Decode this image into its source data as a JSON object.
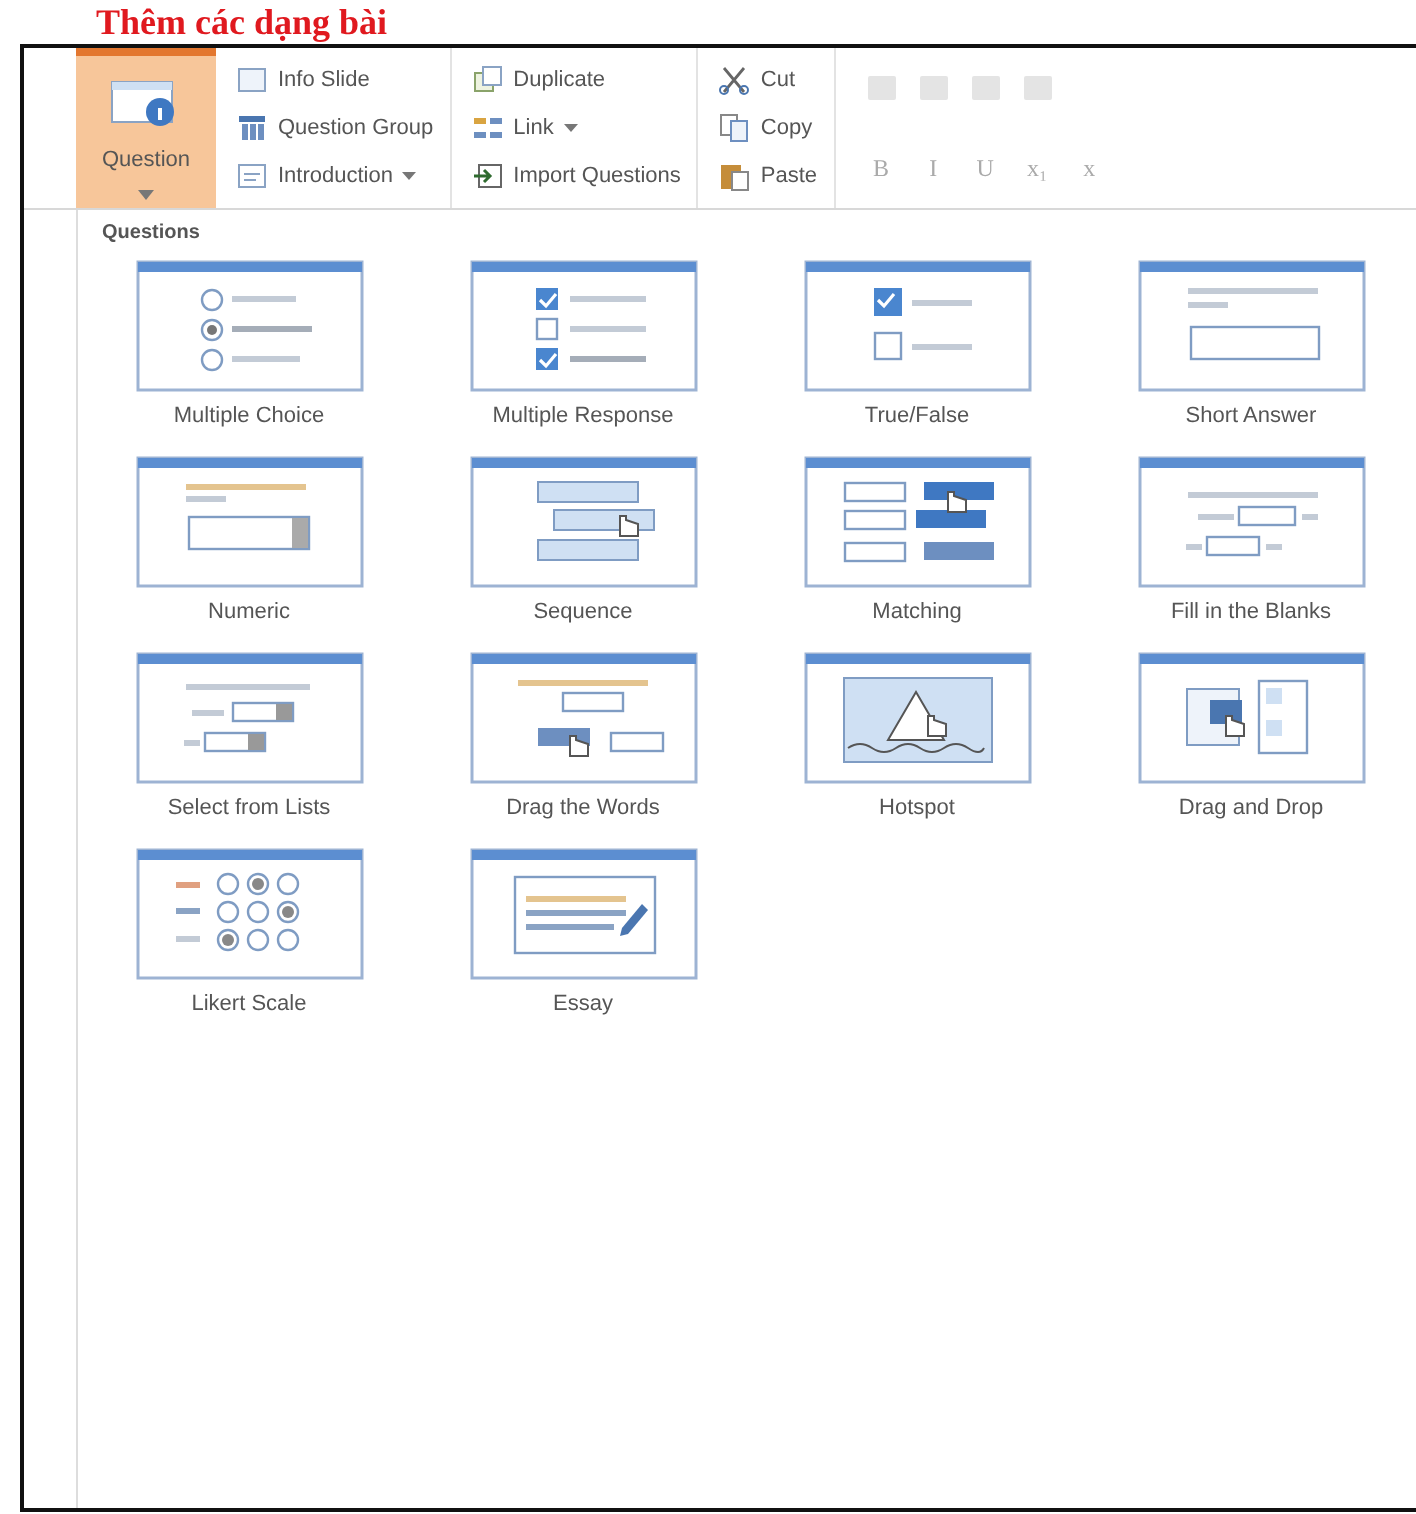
{
  "heading": "Thêm các dạng bài",
  "ribbon": {
    "question_button": {
      "label": "Question",
      "selected": true
    },
    "insert_items": [
      {
        "label": "Info Slide",
        "kind": "slide",
        "dropdown": false
      },
      {
        "label": "Question Group",
        "kind": "group",
        "dropdown": false
      },
      {
        "label": "Introduction",
        "kind": "intro",
        "dropdown": true
      },
      {
        "label": "Duplicate",
        "kind": "duplicate",
        "dropdown": false
      },
      {
        "label": "Link",
        "kind": "link",
        "dropdown": true
      },
      {
        "label": "Import Questions",
        "kind": "import",
        "dropdown": false
      }
    ],
    "clipboard": [
      {
        "label": "Cut",
        "kind": "cut"
      },
      {
        "label": "Copy",
        "kind": "copy"
      },
      {
        "label": "Paste",
        "kind": "paste"
      }
    ],
    "format_buttons": [
      "B",
      "I",
      "U",
      "x₁",
      "x"
    ]
  },
  "gallery": {
    "title": "Questions",
    "items": [
      {
        "label": "Multiple Choice",
        "kind": "multiple_choice"
      },
      {
        "label": "Multiple Response",
        "kind": "multiple_response"
      },
      {
        "label": "True/False",
        "kind": "true_false"
      },
      {
        "label": "Short Answer",
        "kind": "short_answer"
      },
      {
        "label": "Numeric",
        "kind": "numeric"
      },
      {
        "label": "Sequence",
        "kind": "sequence"
      },
      {
        "label": "Matching",
        "kind": "matching"
      },
      {
        "label": "Fill in the Blanks",
        "kind": "fill_blanks"
      },
      {
        "label": "Select from Lists",
        "kind": "select_lists"
      },
      {
        "label": "Drag the Words",
        "kind": "drag_words"
      },
      {
        "label": "Hotspot",
        "kind": "hotspot"
      },
      {
        "label": "Drag and Drop",
        "kind": "drag_drop"
      },
      {
        "label": "Likert Scale",
        "kind": "likert"
      },
      {
        "label": "Essay",
        "kind": "essay"
      }
    ]
  }
}
